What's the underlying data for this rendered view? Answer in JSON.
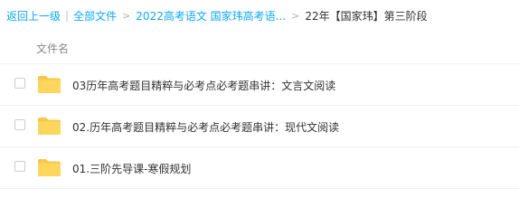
{
  "breadcrumb": {
    "back_label": "返回上一级",
    "all_files_label": "全部文件",
    "parent_folder_label": "2022高考语文 国家玮高考语...",
    "current_folder_label": "22年【国家玮】第三阶段",
    "separator_bar": "|",
    "separator_arrow": ">"
  },
  "list": {
    "header_label": "文件名",
    "rows": [
      {
        "name": "03历年高考题目精粹与必考点必考题串讲：文言文阅读",
        "type": "folder-icon"
      },
      {
        "name": "02.历年高考题目精粹与必考点必考题串讲：现代文阅读",
        "type": "folder-icon"
      },
      {
        "name": "01.三阶先导课-寒假规划",
        "type": "folder-icon"
      }
    ]
  },
  "colors": {
    "link": "#09aaff",
    "folder": "#ffd65c",
    "folder_tab": "#f7c74a",
    "text": "#333333",
    "muted": "#888888"
  }
}
